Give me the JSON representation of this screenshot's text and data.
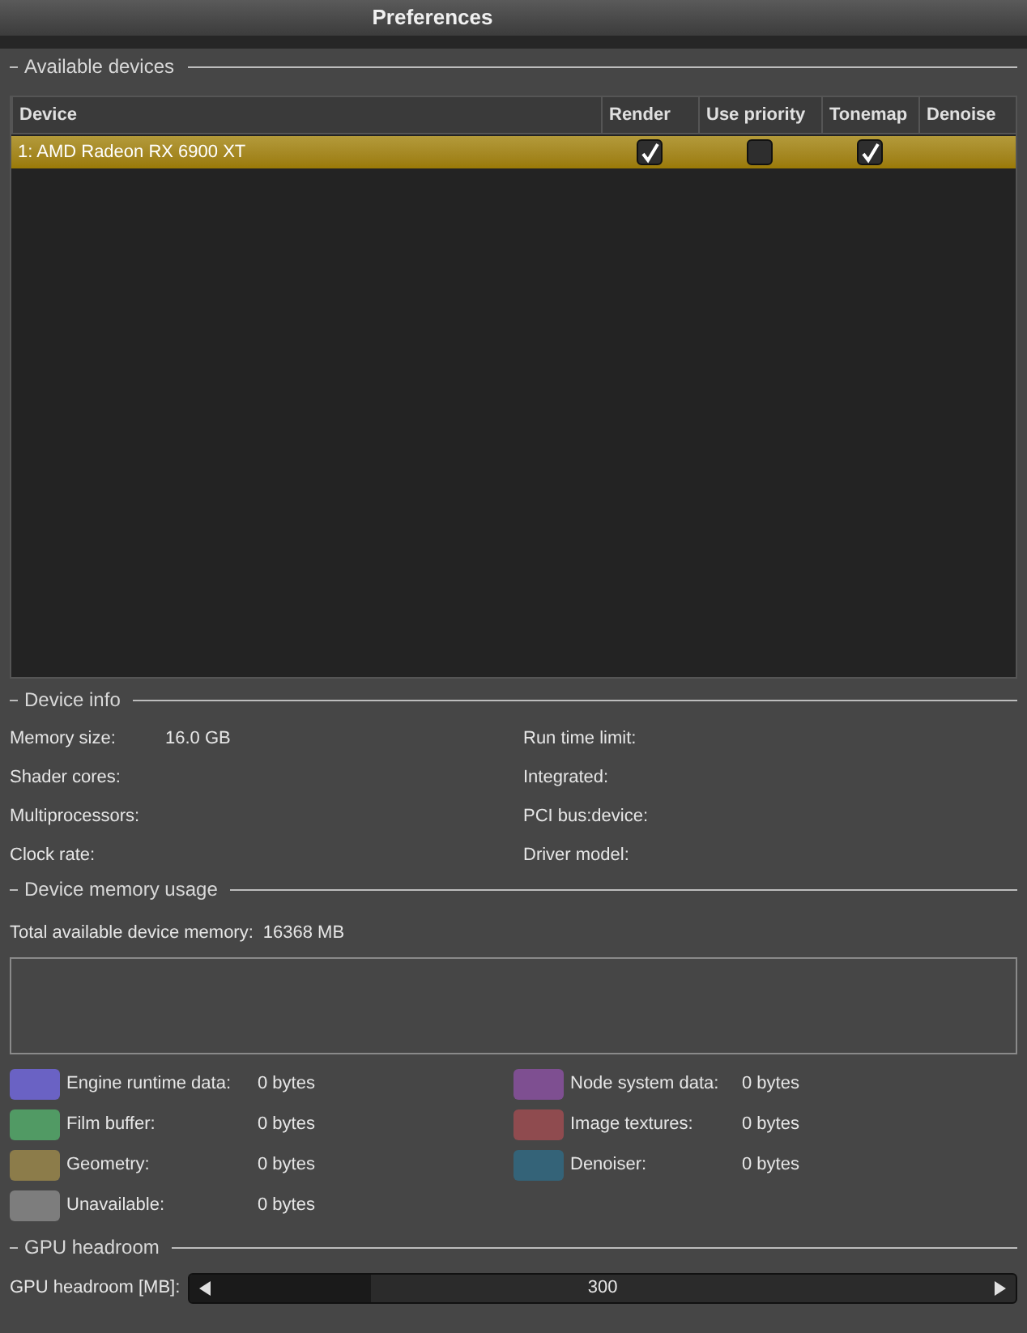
{
  "window": {
    "title": "Preferences"
  },
  "available_devices": {
    "title": "Available devices",
    "columns": [
      "Device",
      "Render",
      "Use priority",
      "Tonemap",
      "Denoise"
    ],
    "rows": [
      {
        "device": "1: AMD Radeon RX 6900 XT",
        "selected": true,
        "render": true,
        "use_priority": false,
        "tonemap": true
      }
    ]
  },
  "device_info": {
    "title": "Device info",
    "left": [
      {
        "label": "Memory size:",
        "value": "16.0 GB"
      },
      {
        "label": "Shader cores:"
      },
      {
        "label": "Multiprocessors:"
      },
      {
        "label": "Clock rate:"
      }
    ],
    "right": [
      {
        "label": "Run time limit:"
      },
      {
        "label": "Integrated:"
      },
      {
        "label": "PCI bus:device:"
      },
      {
        "label": "Driver model:"
      }
    ]
  },
  "device_memory_usage": {
    "title": "Device memory usage",
    "total_label": "Total available device memory:",
    "total_value": "16368 MB",
    "legend": [
      {
        "label": "Engine runtime data:",
        "value": "0 bytes",
        "color": "#6a62c4"
      },
      {
        "label": "Node system data:",
        "value": "0 bytes",
        "color": "#7e4f91"
      },
      {
        "label": "Film buffer:",
        "value": "0 bytes",
        "color": "#519a64"
      },
      {
        "label": "Image textures:",
        "value": "0 bytes",
        "color": "#8f4b4f"
      },
      {
        "label": "Geometry:",
        "value": "0 bytes",
        "color": "#8c7c4a"
      },
      {
        "label": "Denoiser:",
        "value": "0 bytes",
        "color": "#346378"
      },
      {
        "label": "Unavailable:",
        "value": "0 bytes",
        "color": "#7d7d7d"
      }
    ]
  },
  "gpu_headroom": {
    "title": "GPU headroom",
    "label": "GPU headroom [MB]:",
    "value": "300",
    "level": 0.22
  }
}
